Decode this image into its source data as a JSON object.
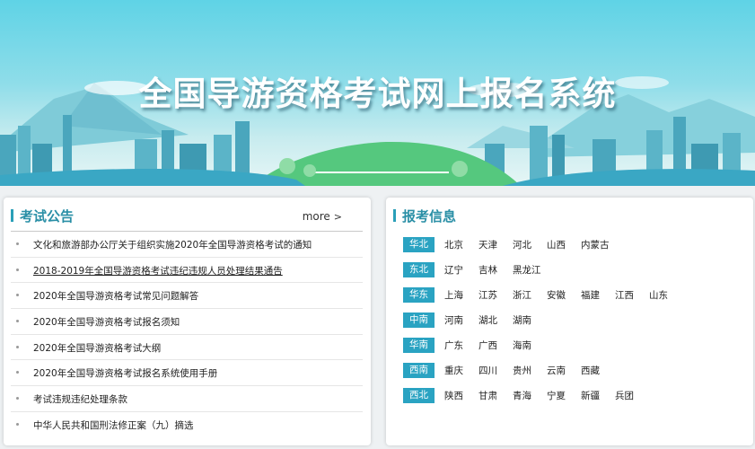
{
  "banner": {
    "title": "全国导游资格考试网上报名系统"
  },
  "notices": {
    "heading": "考试公告",
    "more_label": "more",
    "more_arrow": ">",
    "items": [
      "文化和旅游部办公厅关于组织实施2020年全国导游资格考试的通知",
      "2018-2019年全国导游资格考试违纪违规人员处理结果通告",
      "2020年全国导游资格考试常见问题解答",
      "2020年全国导游资格考试报名须知",
      "2020年全国导游资格考试大纲",
      "2020年全国导游资格考试报名系统使用手册",
      "考试违规违纪处理条款",
      "中华人民共和国刑法修正案（九）摘选"
    ]
  },
  "registration": {
    "heading": "报考信息",
    "regions": [
      {
        "name": "华北",
        "provinces": [
          "北京",
          "天津",
          "河北",
          "山西",
          "内蒙古"
        ]
      },
      {
        "name": "东北",
        "provinces": [
          "辽宁",
          "吉林",
          "黑龙江"
        ]
      },
      {
        "name": "华东",
        "provinces": [
          "上海",
          "江苏",
          "浙江",
          "安徽",
          "福建",
          "江西",
          "山东"
        ]
      },
      {
        "name": "中南",
        "provinces": [
          "河南",
          "湖北",
          "湖南"
        ]
      },
      {
        "name": "华南",
        "provinces": [
          "广东",
          "广西",
          "海南"
        ]
      },
      {
        "name": "西南",
        "provinces": [
          "重庆",
          "四川",
          "贵州",
          "云南",
          "西藏"
        ]
      },
      {
        "name": "西北",
        "provinces": [
          "陕西",
          "甘肃",
          "青海",
          "宁夏",
          "新疆",
          "兵团"
        ]
      }
    ]
  },
  "colors": {
    "accent": "#2aa3c2",
    "heading": "#2a8fa6"
  }
}
